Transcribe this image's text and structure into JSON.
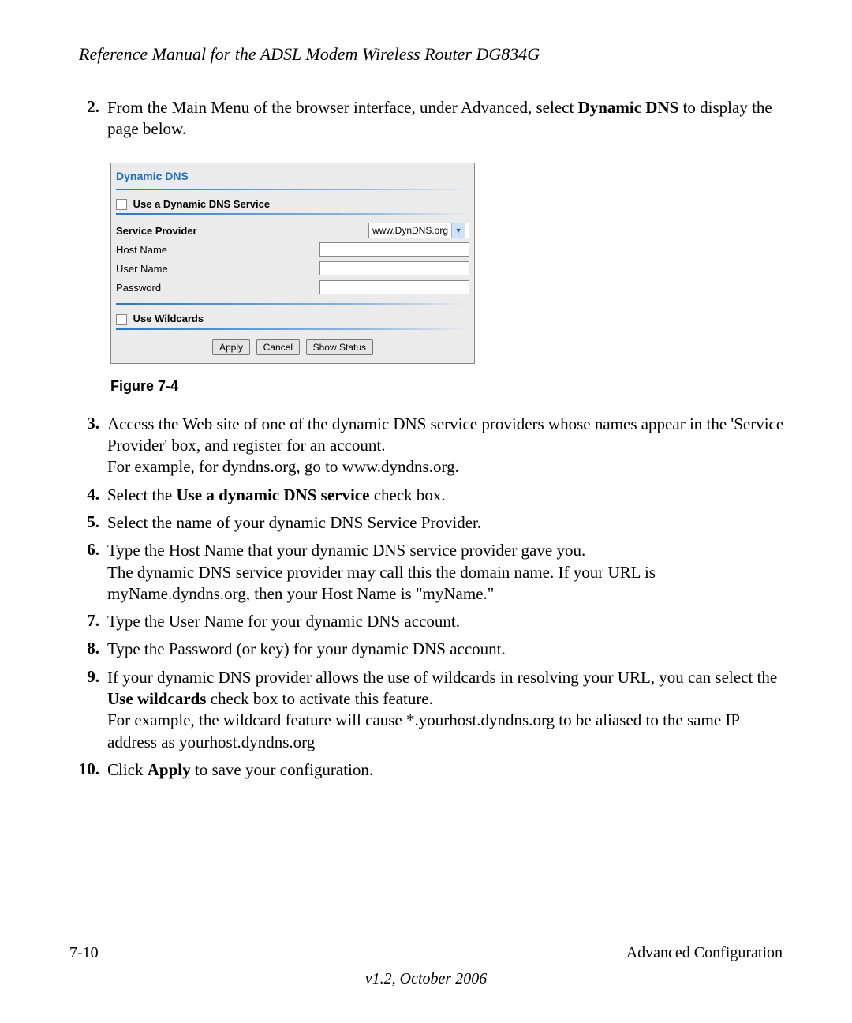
{
  "header": {
    "title": "Reference Manual for the ADSL Modem Wireless Router DG834G"
  },
  "steps": {
    "s2": {
      "num": "2.",
      "p1": "From the Main Menu of the browser interface, under Advanced, select ",
      "b1": "Dynamic DNS",
      "p2": " to display the page below."
    },
    "s3": {
      "num": "3.",
      "p1": "Access the Web site of one of the dynamic DNS service providers whose names appear in the 'Service Provider' box, and register for an account.",
      "p2": "For example, for dyndns.org, go to www.dyndns.org."
    },
    "s4": {
      "num": "4.",
      "p1": "Select the ",
      "b1": "Use a dynamic DNS service",
      "p2": " check box."
    },
    "s5": {
      "num": "5.",
      "p1": "Select the name of your dynamic DNS Service Provider."
    },
    "s6": {
      "num": "6.",
      "p1": "Type the Host Name that your dynamic DNS service provider gave you.",
      "p2": "The dynamic DNS service provider may call this the domain name. If your URL is myName.dyndns.org, then your Host Name is \"myName.\""
    },
    "s7": {
      "num": "7.",
      "p1": "Type the User Name for your dynamic DNS account."
    },
    "s8": {
      "num": "8.",
      "p1": "Type the Password (or key) for your dynamic DNS account."
    },
    "s9": {
      "num": "9.",
      "p1": "If your dynamic DNS provider allows the use of wildcards in resolving your URL, you can select the ",
      "b1": "Use wildcards",
      "p2": " check box to activate this feature.",
      "p3": "For example, the wildcard feature will cause *.yourhost.dyndns.org to be aliased to the same IP address as yourhost.dyndns.org"
    },
    "s10": {
      "num": "10.",
      "p1": "Click ",
      "b1": "Apply",
      "p2": " to save your configuration."
    }
  },
  "figure": {
    "caption": "Figure 7-4",
    "title": "Dynamic DNS",
    "use_ddns_label": "Use a Dynamic DNS Service",
    "service_provider_label": "Service Provider",
    "service_provider_value": "www.DynDNS.org",
    "host_name_label": "Host Name",
    "user_name_label": "User Name",
    "password_label": "Password",
    "use_wildcards_label": "Use Wildcards",
    "btn_apply": "Apply",
    "btn_cancel": "Cancel",
    "btn_show_status": "Show Status"
  },
  "footer": {
    "page_num": "7-10",
    "section": "Advanced Configuration",
    "version": "v1.2, October 2006"
  }
}
